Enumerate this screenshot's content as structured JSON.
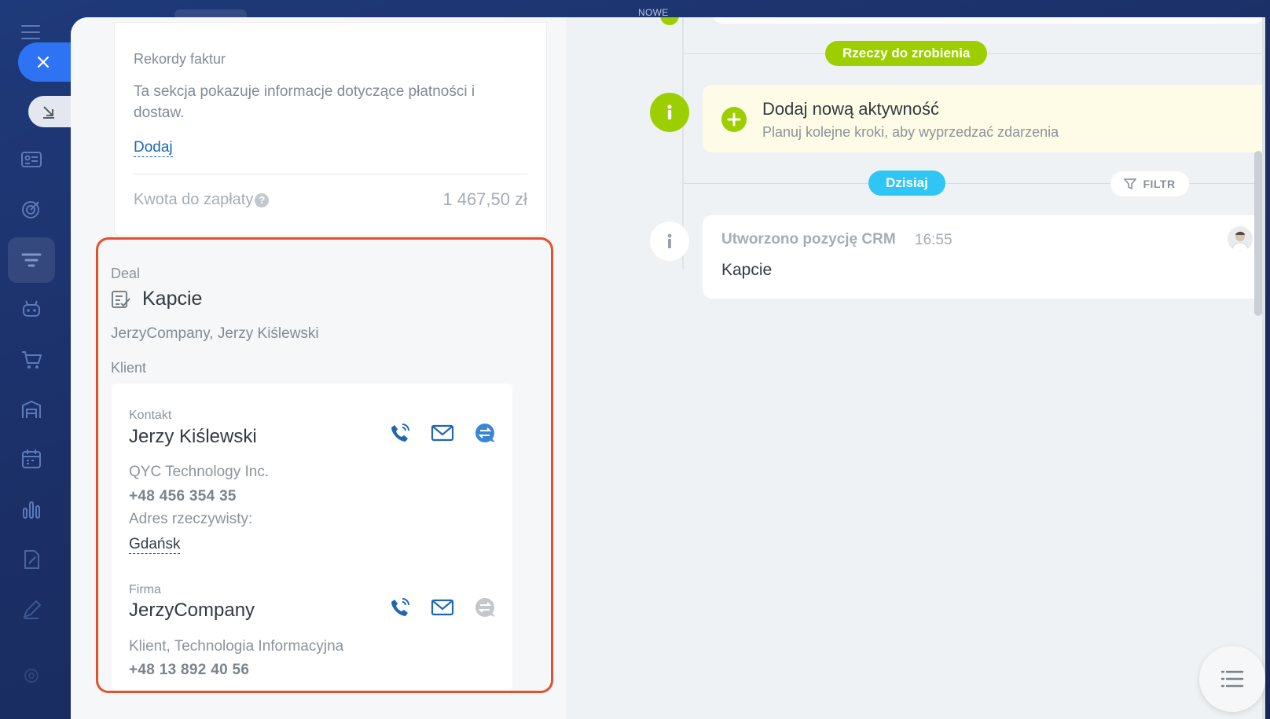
{
  "background": {
    "stage_label": "NOWE"
  },
  "invoice": {
    "title": "Rekordy faktur",
    "description": "Ta sekcja pokazuje informacje dotyczące płatności i dostaw.",
    "add_link": "Dodaj",
    "amount_label": "Kwota do zapłaty",
    "amount_value": "1 467,50 zł"
  },
  "deal": {
    "label": "Deal",
    "title": "Kapcie",
    "subtitle": "JerzyCompany, Jerzy Kiślewski",
    "client_label": "Klient",
    "contact": {
      "type_label": "Kontakt",
      "name": "Jerzy Kiślewski",
      "company": "QYC Technology Inc.",
      "phone": "+48 456 354 35",
      "address_label": "Adres rzeczywisty:",
      "address_city": "Gdańsk"
    },
    "company": {
      "type_label": "Firma",
      "name": "JerzyCompany",
      "details": "Klient, Technologia Informacyjna",
      "phone": "+48 13 892 40 56"
    }
  },
  "timeline": {
    "todo_badge": "Rzeczy do zrobienia",
    "new_activity_title": "Dodaj nową aktywność",
    "new_activity_subtitle": "Planuj kolejne kroki, aby wyprzedzać zdarzenia",
    "today_badge": "Dzisiaj",
    "filter_label": "FILTR",
    "event": {
      "title": "Utworzono pozycję CRM",
      "time": "16:55",
      "body": "Kapcie"
    }
  },
  "colors": {
    "accent_green": "#9dcf00",
    "accent_blue": "#2fc6f6",
    "highlight_frame": "#e4502c",
    "link_blue": "#2067b0"
  },
  "icons": {
    "sidebar": [
      "menu-icon",
      "close-icon",
      "collapse-icon",
      "contact-card-icon",
      "target-icon",
      "funnel-icon",
      "robot-icon",
      "cart-icon",
      "warehouse-icon",
      "calendar-icon",
      "chart-icon",
      "document-edit-icon",
      "pen-icon",
      "settings-icon"
    ]
  }
}
